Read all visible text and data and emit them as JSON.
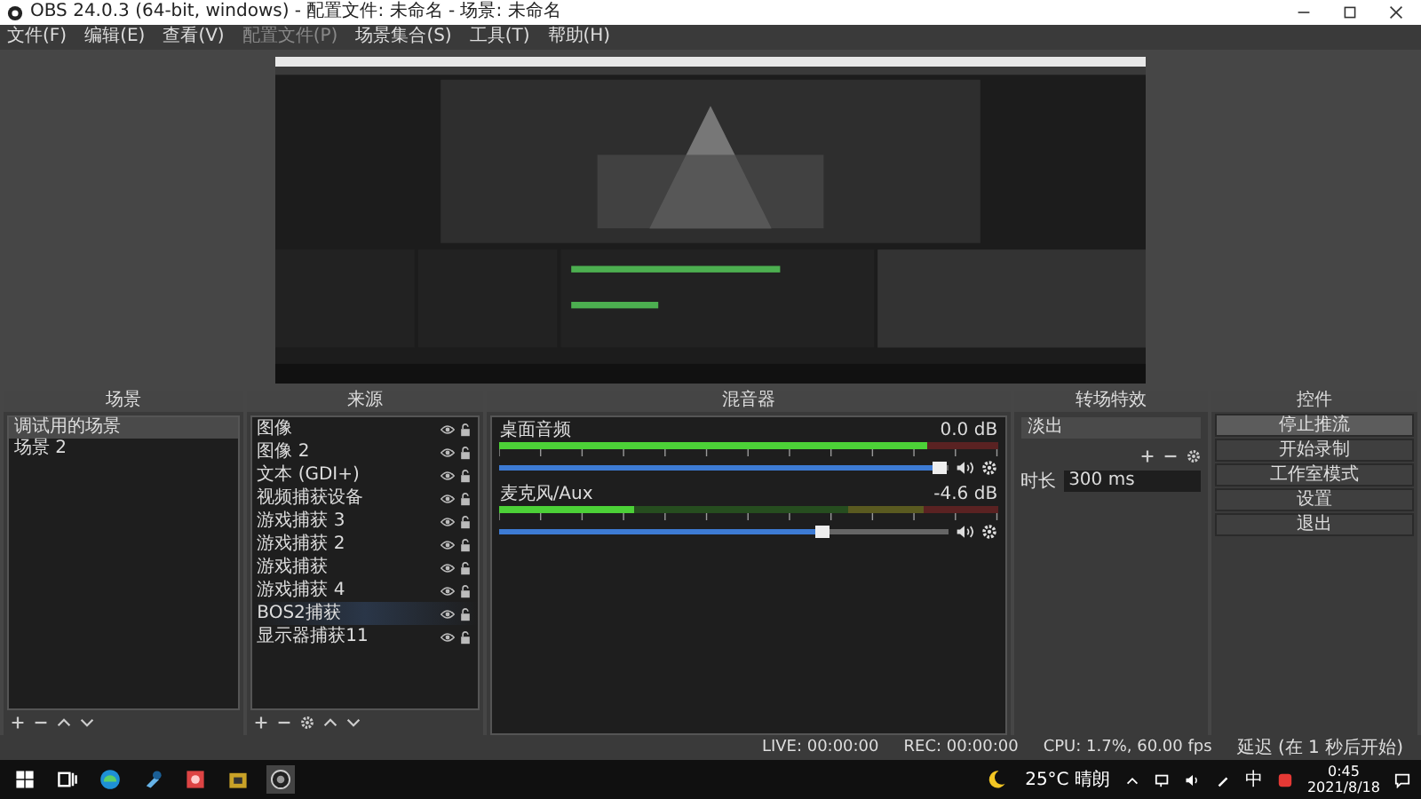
{
  "window": {
    "title": "OBS 24.0.3 (64-bit, windows) - 配置文件: 未命名 - 场景: 未命名"
  },
  "menu": [
    {
      "label": "文件(F)",
      "disabled": false
    },
    {
      "label": "编辑(E)",
      "disabled": false
    },
    {
      "label": "查看(V)",
      "disabled": false
    },
    {
      "label": "配置文件(P)",
      "disabled": true
    },
    {
      "label": "场景集合(S)",
      "disabled": false
    },
    {
      "label": "工具(T)",
      "disabled": false
    },
    {
      "label": "帮助(H)",
      "disabled": false
    }
  ],
  "scenes": {
    "title": "场景",
    "items": [
      {
        "label": "调试用的场景",
        "selected": true
      },
      {
        "label": "场景 2",
        "selected": false
      }
    ]
  },
  "sources": {
    "title": "来源",
    "items": [
      {
        "label": "图像",
        "selected": false
      },
      {
        "label": "图像 2",
        "selected": false
      },
      {
        "label": "文本 (GDI+)",
        "selected": false
      },
      {
        "label": "视频捕获设备",
        "selected": false
      },
      {
        "label": "游戏捕获 3",
        "selected": false
      },
      {
        "label": "游戏捕获 2",
        "selected": false
      },
      {
        "label": "游戏捕获",
        "selected": false
      },
      {
        "label": "游戏捕获 4",
        "selected": false
      },
      {
        "label": "BOS2捕获",
        "selected": true
      },
      {
        "label": "显示器捕获11",
        "selected": false
      }
    ]
  },
  "mixer": {
    "title": "混音器",
    "channels": [
      {
        "name": "桌面音频",
        "reading": "0.0 dB",
        "meter": {
          "level": 0.86
        },
        "volume": {
          "level": 0.98
        }
      },
      {
        "name": "麦克风/Aux",
        "reading": "-4.6 dB",
        "meter": {
          "level": 0.27
        },
        "volume": {
          "level": 0.72
        }
      }
    ]
  },
  "transitions": {
    "title": "转场特效",
    "type": "淡出",
    "duration_label": "时长",
    "duration": "300 ms"
  },
  "controls": {
    "title": "控件",
    "buttons": [
      {
        "label": "停止推流",
        "selected": true
      },
      {
        "label": "开始录制",
        "selected": false
      },
      {
        "label": "工作室模式",
        "selected": false
      },
      {
        "label": "设置",
        "selected": false
      },
      {
        "label": "退出",
        "selected": false
      }
    ]
  },
  "status_bar": {
    "live": "LIVE: 00:00:00",
    "rec": "REC: 00:00:00",
    "cpu": "CPU: 1.7%, 60.00 fps",
    "delay": "延迟 (在 1 秒后开始)"
  },
  "taskbar": {
    "weather": "25°C 晴朗",
    "ime": "中",
    "time": "0:45",
    "date": "2021/8/18"
  }
}
